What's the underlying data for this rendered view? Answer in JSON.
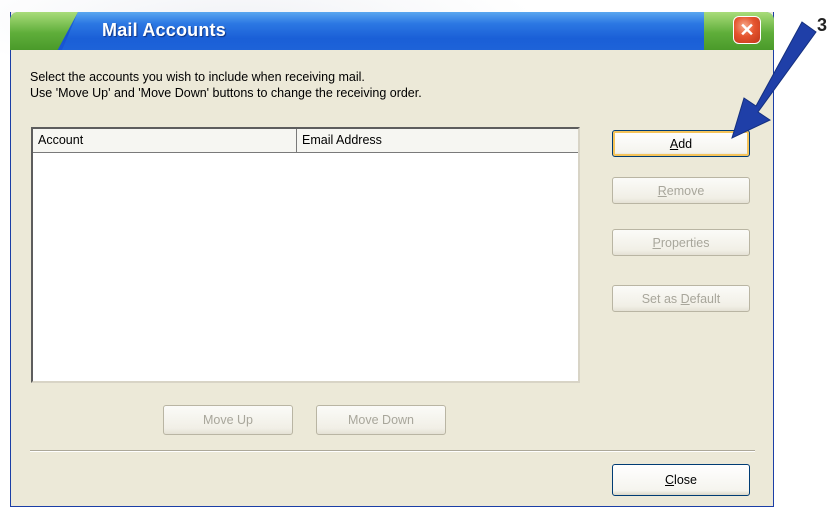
{
  "window": {
    "title": "Mail Accounts",
    "close_symbol": "✕"
  },
  "instructions": {
    "line1": "Select the accounts you wish to include when receiving mail.",
    "line2": "Use 'Move Up' and 'Move Down' buttons to change the receiving order."
  },
  "accounts_table": {
    "columns": [
      "Account",
      "Email Address"
    ],
    "rows": []
  },
  "buttons": {
    "add": {
      "label": "Add",
      "mnemonic": "A",
      "rest": "dd",
      "enabled": true
    },
    "remove": {
      "label": "Remove",
      "mnemonic": "R",
      "rest": "emove",
      "enabled": false
    },
    "properties": {
      "label": "Properties",
      "mnemonic": "P",
      "rest": "roperties",
      "enabled": false
    },
    "set_default": {
      "label": "Set as Default",
      "prefix": "Set as ",
      "mnemonic": "D",
      "rest": "efault",
      "enabled": false
    },
    "move_up": {
      "label": "Move Up",
      "enabled": false
    },
    "move_down": {
      "label": "Move Down",
      "enabled": false
    },
    "close": {
      "label": "Close",
      "mnemonic": "C",
      "rest": "lose",
      "enabled": true
    }
  },
  "annotation": {
    "step_number": "3"
  },
  "colors": {
    "titlebar_blue": "#1552cf",
    "titlebar_green": "#5fae3a",
    "dialog_face": "#ece9d8",
    "close_red": "#e5542e",
    "arrow_blue": "#1f3fa8"
  }
}
